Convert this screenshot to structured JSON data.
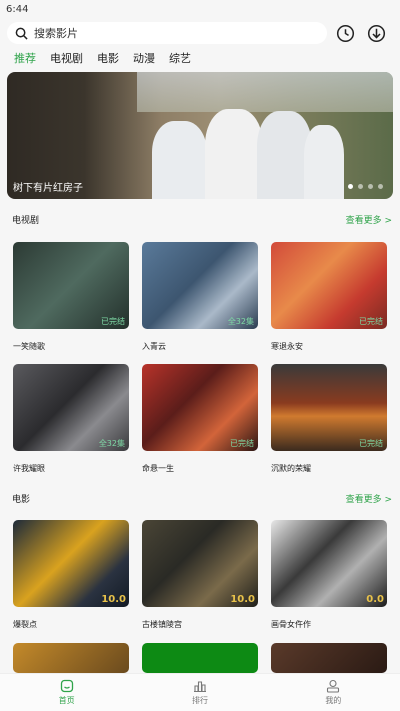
{
  "status": {
    "time": "6:44"
  },
  "search": {
    "placeholder": "搜索影片"
  },
  "tabs": [
    {
      "label": "推荐",
      "active": true
    },
    {
      "label": "电视剧"
    },
    {
      "label": "电影"
    },
    {
      "label": "动漫"
    },
    {
      "label": "综艺"
    }
  ],
  "banner": {
    "title": "树下有片红房子",
    "slides": 4,
    "active_slide": 1
  },
  "sections": [
    {
      "title": "电视剧",
      "more": "查看更多 >",
      "items": [
        {
          "title": "一笑随歌",
          "badge": "已完结"
        },
        {
          "title": "入青云",
          "badge": "全32集"
        },
        {
          "title": "寒退永安",
          "badge": "已完结"
        },
        {
          "title": "许我耀眼",
          "badge": "全32集"
        },
        {
          "title": "命悬一生",
          "badge": "已完结"
        },
        {
          "title": "沉默的荣耀",
          "badge": "已完结"
        }
      ]
    },
    {
      "title": "电影",
      "more": "查看更多 >",
      "items": [
        {
          "title": "爆裂点",
          "score": "10.0"
        },
        {
          "title": "古楼镇陵宫",
          "score": "10.0"
        },
        {
          "title": "画骨女仵作",
          "score": "0.0"
        }
      ]
    }
  ],
  "nav": [
    {
      "label": "首页",
      "icon": "home-icon",
      "active": true
    },
    {
      "label": "排行",
      "icon": "ranking-icon"
    },
    {
      "label": "我的",
      "icon": "user-icon"
    }
  ],
  "colors": {
    "accent": "#2fa34a",
    "background": "#f6f6f6"
  }
}
